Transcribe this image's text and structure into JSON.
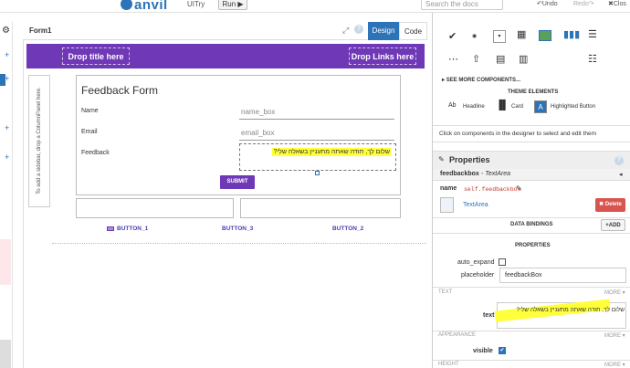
{
  "topbar": {
    "logo": "anvil",
    "app_name": "UITry",
    "run_label": "Run ▶",
    "search_placeholder": "Search the docs",
    "undo_label": "Undo",
    "redo_label": "Redo",
    "close_label": "Clos"
  },
  "editor": {
    "form_name": "Form1",
    "design_tab": "Design",
    "code_tab": "Code"
  },
  "canvas": {
    "drop_title": "Drop title here",
    "drop_links": "Drop Links here",
    "sidebar_hint": "To add a sidebar, drop a ColumnPanel here.",
    "form_title": "Feedback Form",
    "fields": [
      {
        "label": "Name",
        "placeholder": "name_box"
      },
      {
        "label": "Email",
        "placeholder": "email_box"
      },
      {
        "label": "Feedback",
        "value": "שלום לך, תודה שאתה מתעניין בשאלה שלי?"
      }
    ],
    "submit_label": "SUBMIT",
    "links": [
      "BUTTON_1",
      "BUTTON_3",
      "BUTTON_2"
    ]
  },
  "toolbox": {
    "see_more": "SEE MORE COMPONENTS...",
    "theme_heading": "THEME ELEMENTS",
    "theme_items": [
      {
        "icon": "Ab",
        "label": "Headline"
      },
      {
        "icon": "card-icon",
        "label": "Card"
      },
      {
        "icon": "A",
        "label": "Highlighted Button"
      }
    ],
    "hint": "Click on components in the designer to select and edit them"
  },
  "properties": {
    "heading": "Properties",
    "component_name": "feedbackbox",
    "component_type": "TextArea",
    "name_label": "name",
    "name_value": "self.feedbackbox",
    "type_link": "TextArea",
    "delete_label": "✖ Delete",
    "data_bindings": "DATA BINDINGS",
    "add_label": "+ADD",
    "subheading": "PROPERTIES",
    "auto_expand_label": "auto_expand",
    "auto_expand_checked": false,
    "placeholder_label": "placeholder",
    "placeholder_value": "feedbackBox",
    "text_section": "TEXT",
    "more_label": "MORE ▾",
    "text_label": "text",
    "text_value": "שלום לך, תודה שאתה מתעניין בשאלה שלי?",
    "appearance_section": "APPEARANCE",
    "visible_label": "visible",
    "visible_checked": true,
    "height_section": "HEIGHT"
  },
  "colors": {
    "brand_blue": "#2c73b8",
    "header_purple": "#6e38b6",
    "highlight_yellow": "#ffff3a",
    "delete_red": "#d9534f"
  }
}
